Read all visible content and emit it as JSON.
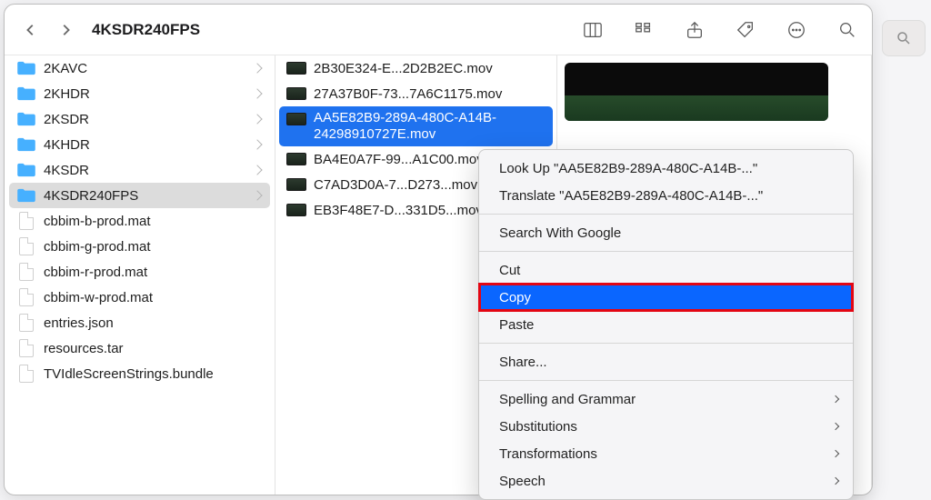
{
  "window": {
    "title": "4KSDR240FPS"
  },
  "sidebar": {
    "items": [
      {
        "label": "2KAVC",
        "type": "folder",
        "selected": false,
        "chevron": true
      },
      {
        "label": "2KHDR",
        "type": "folder",
        "selected": false,
        "chevron": true
      },
      {
        "label": "2KSDR",
        "type": "folder",
        "selected": false,
        "chevron": true
      },
      {
        "label": "4KHDR",
        "type": "folder",
        "selected": false,
        "chevron": true
      },
      {
        "label": "4KSDR",
        "type": "folder",
        "selected": false,
        "chevron": true
      },
      {
        "label": "4KSDR240FPS",
        "type": "folder",
        "selected": true,
        "chevron": true
      },
      {
        "label": "cbbim-b-prod.mat",
        "type": "file",
        "selected": false,
        "chevron": false
      },
      {
        "label": "cbbim-g-prod.mat",
        "type": "file",
        "selected": false,
        "chevron": false
      },
      {
        "label": "cbbim-r-prod.mat",
        "type": "file",
        "selected": false,
        "chevron": false
      },
      {
        "label": "cbbim-w-prod.mat",
        "type": "file",
        "selected": false,
        "chevron": false
      },
      {
        "label": "entries.json",
        "type": "file",
        "selected": false,
        "chevron": false
      },
      {
        "label": "resources.tar",
        "type": "file",
        "selected": false,
        "chevron": false
      },
      {
        "label": "TVIdleScreenStrings.bundle",
        "type": "file",
        "selected": false,
        "chevron": false
      }
    ]
  },
  "files": {
    "items": [
      {
        "label": "2B30E324-E...2D2B2EC.mov",
        "selected": false
      },
      {
        "label": "27A37B0F-73...7A6C1175.mov",
        "selected": false
      },
      {
        "label": "AA5E82B9-289A-480C-A14B-24298910727E.mov",
        "selected": true
      },
      {
        "label": "BA4E0A7F-99...A1C00.mov",
        "selected": false
      },
      {
        "label": "C7AD3D0A-7...D273...mov",
        "selected": false
      },
      {
        "label": "EB3F48E7-D...331D5...mov",
        "selected": false
      }
    ]
  },
  "context_menu": {
    "lookup": "Look Up \"AA5E82B9-289A-480C-A14B-...\"",
    "translate": "Translate \"AA5E82B9-289A-480C-A14B-...\"",
    "search": "Search With Google",
    "cut": "Cut",
    "copy": "Copy",
    "paste": "Paste",
    "share": "Share...",
    "spelling": "Spelling and Grammar",
    "subs": "Substitutions",
    "trans": "Transformations",
    "speech": "Speech",
    "highlighted": "copy"
  }
}
